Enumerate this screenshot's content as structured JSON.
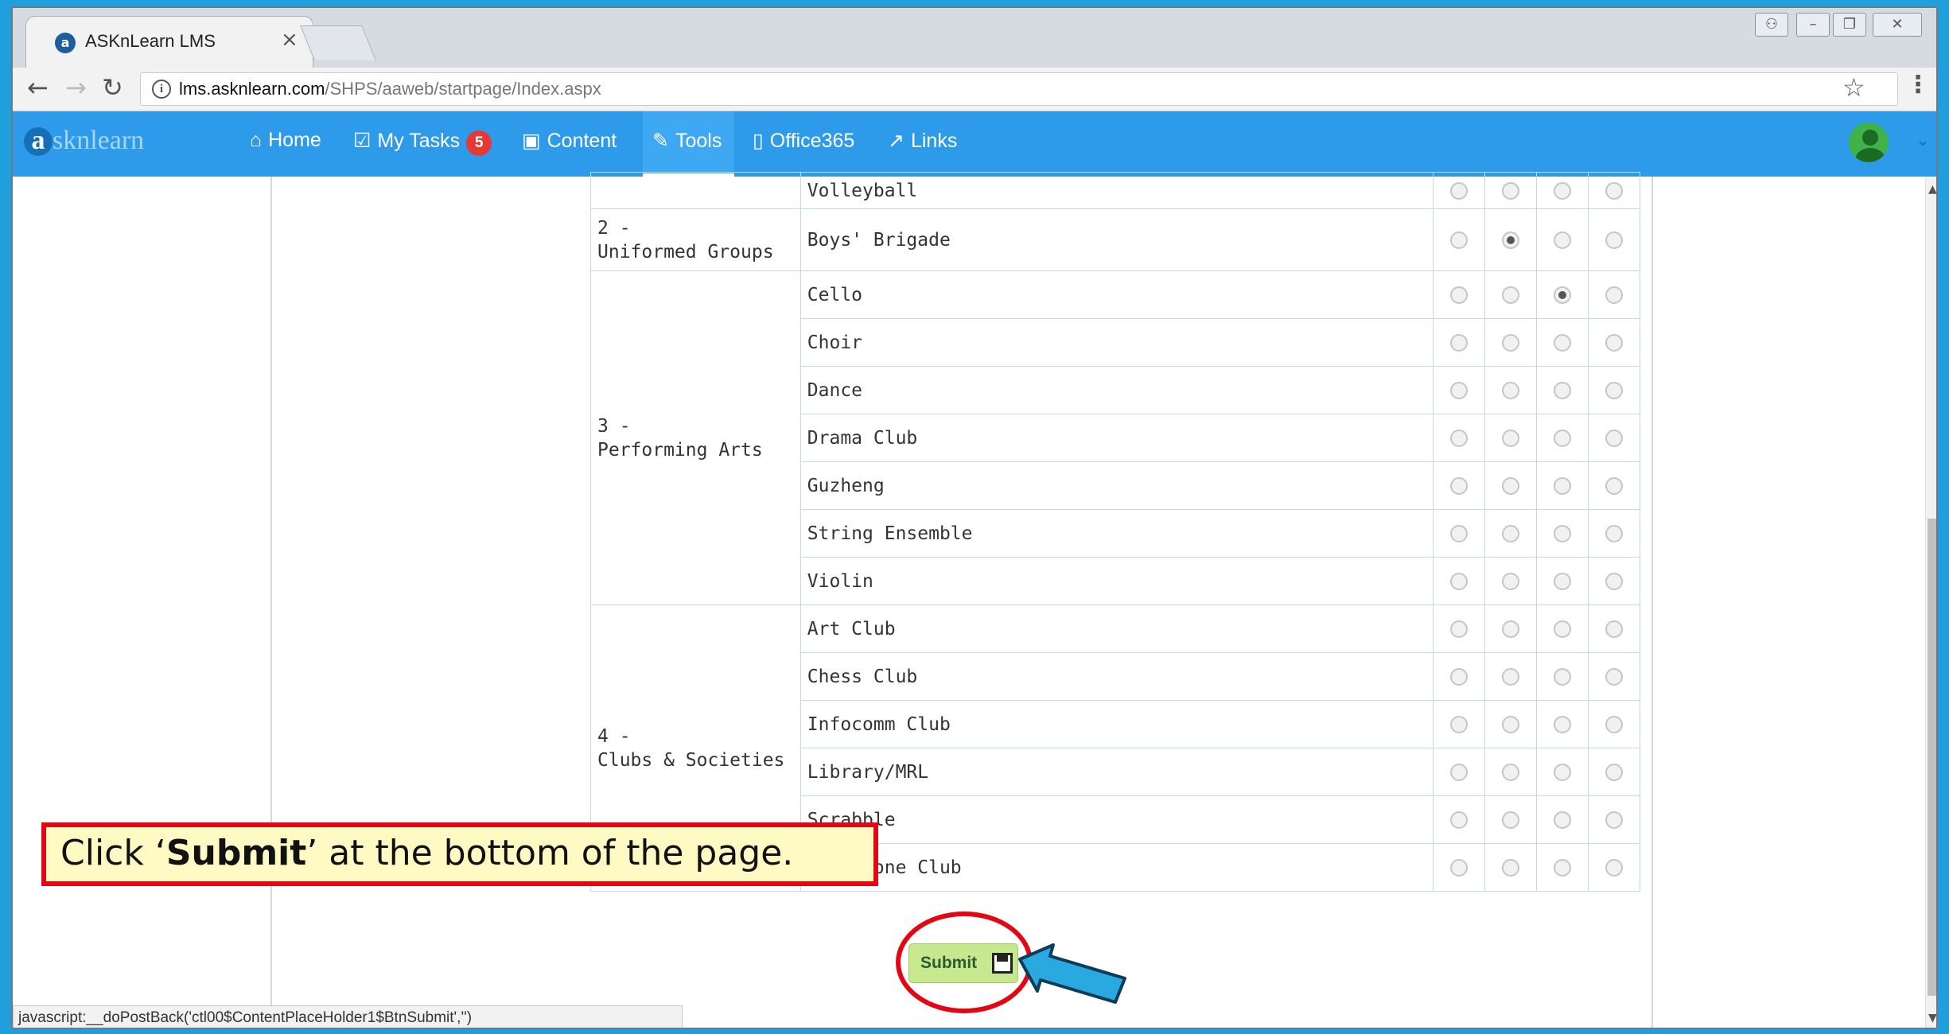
{
  "browser": {
    "tab_title": "ASKnLearn LMS",
    "tab_close": "×",
    "url_host": "lms.asknlearn.com",
    "url_path": "/SHPS/aaweb/startpage/Index.aspx",
    "status_text": "javascript:__doPostBack('ctl00$ContentPlaceHolder1$BtnSubmit','')"
  },
  "app": {
    "logo_text": "sknlearn",
    "logo_mark": "a",
    "nav": [
      {
        "label": "Home",
        "icon": "home-icon"
      },
      {
        "label": "My Tasks",
        "icon": "tasks-icon",
        "badge": "5"
      },
      {
        "label": "Content",
        "icon": "content-icon"
      },
      {
        "label": "Tools",
        "icon": "tools-icon",
        "active": true
      },
      {
        "label": "Office365",
        "icon": "office-icon"
      },
      {
        "label": "Links",
        "icon": "links-icon"
      }
    ]
  },
  "table": {
    "groups": [
      {
        "label": "",
        "activities": [
          {
            "name": "Volleyball",
            "selected": null
          }
        ]
      },
      {
        "label": "2 -\nUniformed Groups",
        "activities": [
          {
            "name": "Boys' Brigade",
            "selected": 1
          }
        ]
      },
      {
        "label": "3 -\nPerforming Arts",
        "activities": [
          {
            "name": "Cello",
            "selected": 2
          },
          {
            "name": "Choir",
            "selected": null
          },
          {
            "name": "Dance",
            "selected": null
          },
          {
            "name": "Drama Club",
            "selected": null
          },
          {
            "name": "Guzheng",
            "selected": null
          },
          {
            "name": "String Ensemble",
            "selected": null
          },
          {
            "name": "Violin",
            "selected": null
          }
        ]
      },
      {
        "label": "4 -\nClubs & Societies",
        "activities": [
          {
            "name": "Art Club",
            "selected": null
          },
          {
            "name": "Chess Club",
            "selected": null
          },
          {
            "name": "Infocomm Club",
            "selected": null
          },
          {
            "name": "Library/MRL",
            "selected": null
          },
          {
            "name": "Scrabble",
            "selected": null
          },
          {
            "name": "Xylophone Club",
            "selected": null
          }
        ]
      }
    ]
  },
  "submit": {
    "label": "Submit"
  },
  "callout": {
    "prefix": "Click ‘",
    "bold": "Submit",
    "suffix": "’ at the bottom of the page."
  },
  "colors": {
    "nav_bar": "#2e9bea",
    "annotation_red": "#e30613",
    "arrow_blue": "#29a9e0",
    "submit_green": "#c8e890"
  }
}
